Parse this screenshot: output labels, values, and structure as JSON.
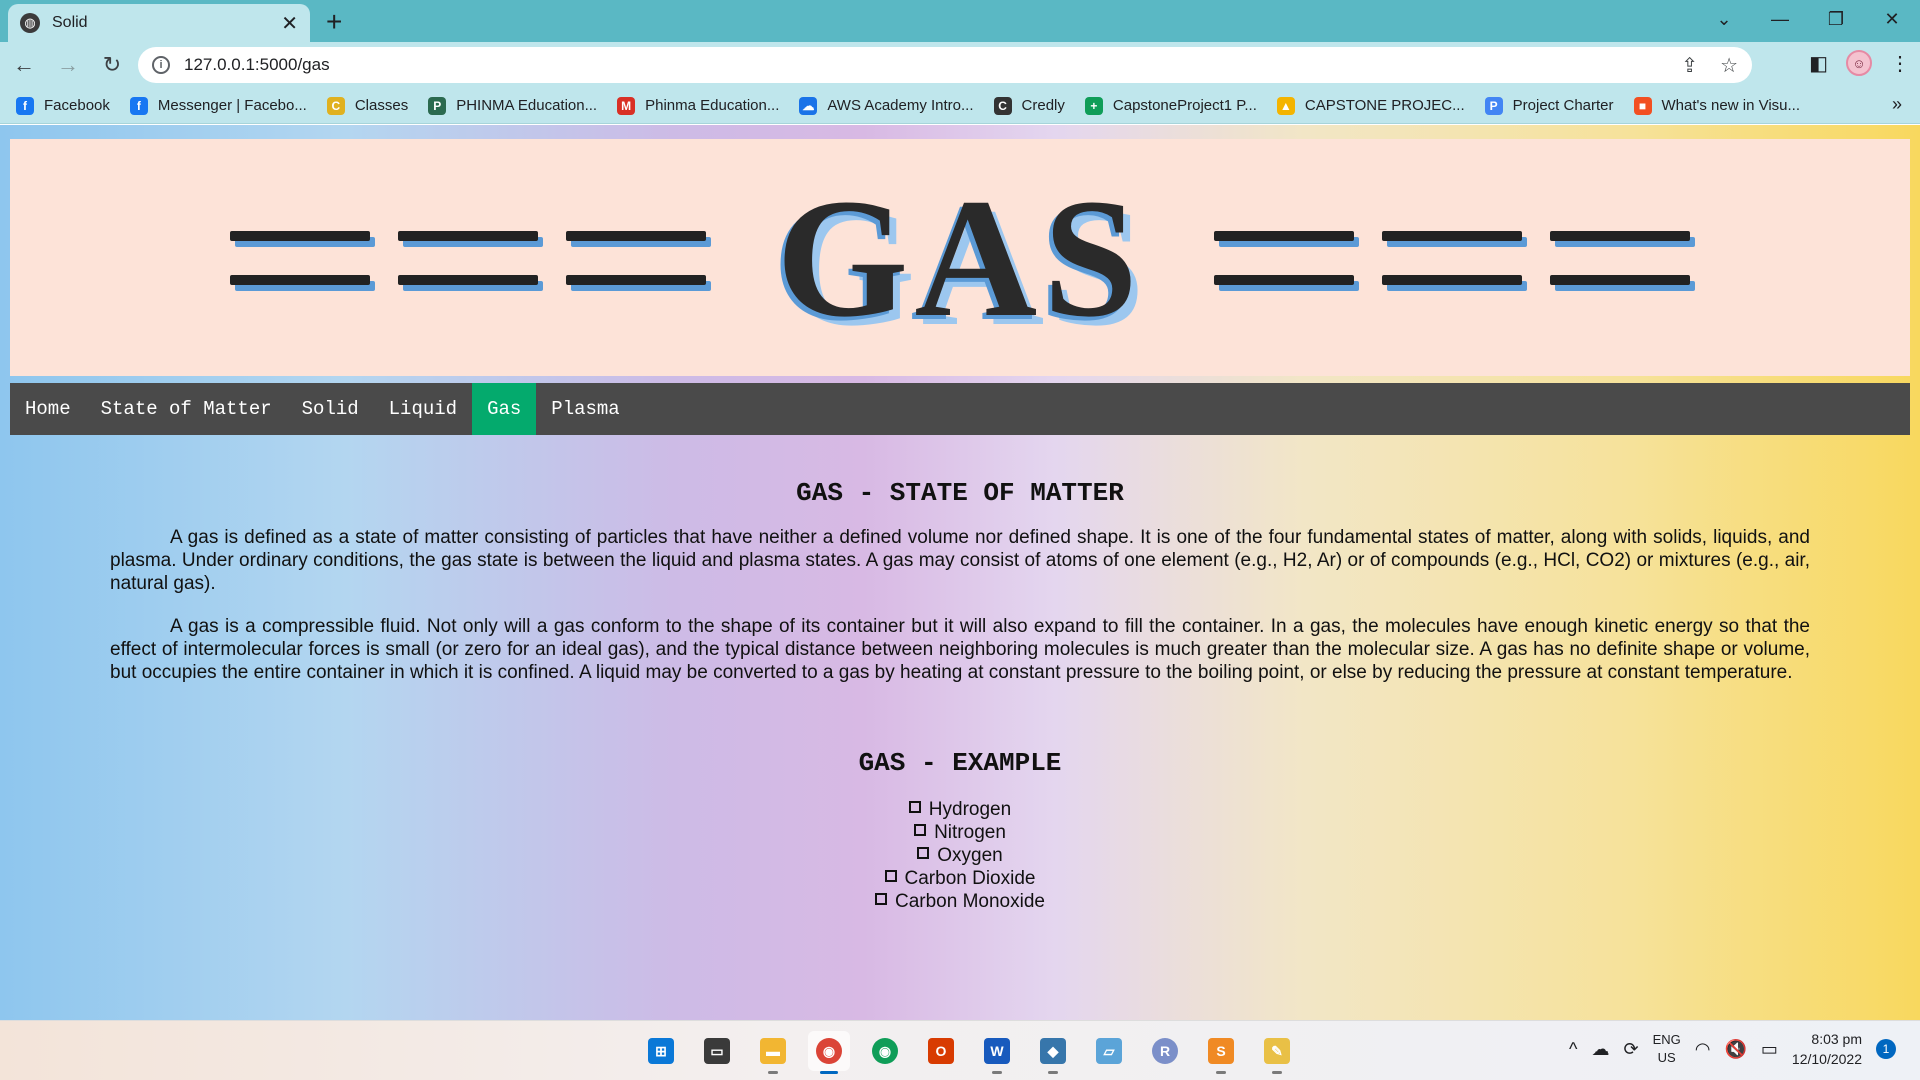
{
  "browser": {
    "tab_title": "Solid",
    "url": "127.0.0.1:5000/gas",
    "bookmarks": [
      {
        "label": "Facebook",
        "color": "#1877f2",
        "icon": "f"
      },
      {
        "label": "Messenger | Facebo...",
        "color": "#1877f2",
        "icon": "f"
      },
      {
        "label": "Classes",
        "color": "#e0b11f",
        "icon": "C"
      },
      {
        "label": "PHINMA Education...",
        "color": "#2b6a4f",
        "icon": "P"
      },
      {
        "label": "Phinma Education...",
        "color": "#d93025",
        "icon": "M"
      },
      {
        "label": "AWS Academy Intro...",
        "color": "#1a73e8",
        "icon": "☁"
      },
      {
        "label": "Credly",
        "color": "#333333",
        "icon": "C"
      },
      {
        "label": "CapstoneProject1 P...",
        "color": "#0f9d58",
        "icon": "+"
      },
      {
        "label": "CAPSTONE PROJEC...",
        "color": "#f4b400",
        "icon": "▲"
      },
      {
        "label": "Project Charter",
        "color": "#4285f4",
        "icon": "P"
      },
      {
        "label": "What's new in Visu...",
        "color": "#f25022",
        "icon": "■"
      }
    ]
  },
  "page": {
    "banner_title": "GAS",
    "nav": [
      "Home",
      "State of Matter",
      "Solid",
      "Liquid",
      "Gas",
      "Plasma"
    ],
    "active_nav": "Gas",
    "section1_title": "GAS - STATE OF MATTER",
    "paragraph1": "A gas is defined as a state of matter consisting of particles that have neither a defined volume nor defined shape. It is one of the four fundamental states of matter, along with solids, liquids, and plasma. Under ordinary conditions, the gas state is between the liquid and plasma states. A gas may consist of atoms of one element (e.g., H2, Ar) or of compounds (e.g., HCl, CO2) or mixtures (e.g., air, natural gas).",
    "paragraph2": "A gas is a compressible fluid. Not only will a gas conform to the shape of its container but it will also expand to fill the container. In a gas, the molecules have enough kinetic energy so that the effect of intermolecular forces is small (or zero for an ideal gas), and the typical distance between neighboring molecules is much greater than the molecular size. A gas has no definite shape or volume, but occupies the entire container in which it is confined. A liquid may be converted to a gas by heating at constant pressure to the boiling point, or else by reducing the pressure at constant temperature.",
    "section2_title": "GAS - EXAMPLE",
    "examples": [
      "Hydrogen",
      "Nitrogen",
      "Oxygen",
      "Carbon Dioxide",
      "Carbon Monoxide"
    ]
  },
  "taskbar": {
    "lang_top": "ENG",
    "lang_bottom": "US",
    "time": "8:03 pm",
    "date": "12/10/2022",
    "notifications": "1"
  }
}
